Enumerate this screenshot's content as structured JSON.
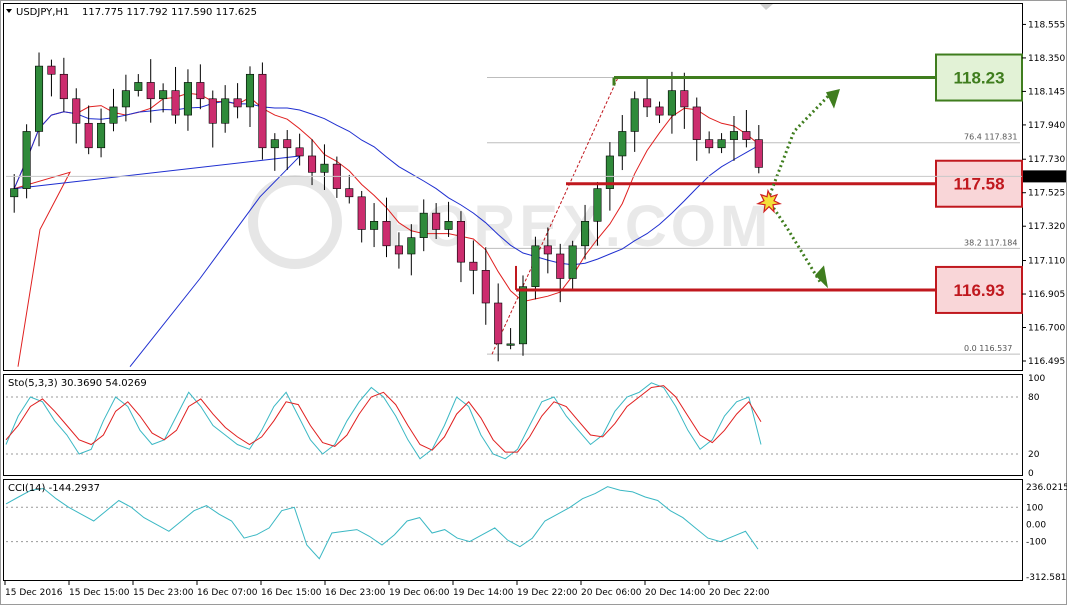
{
  "header": {
    "symbol": "USDJPY,H1",
    "ohlc": "117.775 117.792 117.590 117.625",
    "dropdown_icon": "triangle-down-icon",
    "corner_icon": "chart-window-corner-icon"
  },
  "colors": {
    "bull": "#2f8a3a",
    "bear": "#cc2d6e",
    "ma_fast": "#e02020",
    "ma_slow": "#1f2fd0",
    "stoch_main": "#3bb8c4",
    "stoch_signal": "#e02020",
    "cci": "#3bb8c4",
    "green_level": "#3f7d1e",
    "red_level": "#c0181e",
    "green_box_fill": "#e2f2d6",
    "red_box_fill": "#f9d6d8"
  },
  "chart_data": {
    "type": "candlestick",
    "title": "USDJPY,H1",
    "ylim": [
      116.44,
      118.68
    ],
    "y_ticks": [
      "118.555",
      "118.350",
      "118.145",
      "117.940",
      "117.730",
      "117.525",
      "117.320",
      "117.110",
      "116.905",
      "116.700",
      "116.495"
    ],
    "current_price": "117.625",
    "x_ticks": [
      "15 Dec 2016",
      "15 Dec 15:00",
      "15 Dec 23:00",
      "16 Dec 07:00",
      "16 Dec 15:00",
      "16 Dec 23:00",
      "19 Dec 06:00",
      "19 Dec 14:00",
      "19 Dec 22:00",
      "20 Dec 06:00",
      "20 Dec 14:00",
      "20 Dec 22:00"
    ],
    "candles_summary": "hourly USDJPY bars from 15 Dec 2016 to 20 Dec 2016",
    "close_path": [
      117.55,
      117.9,
      118.3,
      118.25,
      118.1,
      117.95,
      117.8,
      117.95,
      118.05,
      118.15,
      118.2,
      118.1,
      118.15,
      118.0,
      118.2,
      118.1,
      117.95,
      118.1,
      118.05,
      118.25,
      117.8,
      117.85,
      117.8,
      117.75,
      117.65,
      117.7,
      117.55,
      117.5,
      117.3,
      117.35,
      117.2,
      117.15,
      117.25,
      117.4,
      117.3,
      117.35,
      117.1,
      117.05,
      116.85,
      116.6,
      116.6,
      116.95,
      117.2,
      117.15,
      117.0,
      117.2,
      117.35,
      117.55,
      117.75,
      117.9,
      118.1,
      118.05,
      118.0,
      118.15,
      118.05,
      117.85,
      117.8,
      117.85,
      117.9,
      117.85,
      117.68
    ],
    "fibonacci": {
      "levels": [
        {
          "label": "76.4",
          "value": "117.831",
          "price": 117.831
        },
        {
          "label": "38.2",
          "value": "117.184",
          "price": 117.184
        },
        {
          "label": "0.0",
          "value": "116.537",
          "price": 116.537
        }
      ],
      "top": 118.23
    },
    "levels": [
      {
        "label": "118.23",
        "price": 118.23,
        "kind": "resistance"
      },
      {
        "label": "117.58",
        "price": 117.58,
        "kind": "pivot"
      },
      {
        "label": "116.93",
        "price": 116.93,
        "kind": "support"
      }
    ],
    "watermark": "FOREX.COM"
  },
  "stochastic": {
    "label": "Sto(5,3,3) 30.3690 54.0269",
    "axis": [
      "100",
      "80",
      "20",
      "0"
    ],
    "ylim": [
      0,
      100
    ],
    "main": [
      30,
      60,
      80,
      75,
      55,
      40,
      20,
      25,
      55,
      80,
      70,
      45,
      30,
      35,
      60,
      85,
      70,
      50,
      40,
      30,
      25,
      45,
      70,
      85,
      60,
      35,
      20,
      30,
      55,
      75,
      90,
      80,
      60,
      35,
      15,
      25,
      50,
      80,
      70,
      40,
      20,
      15,
      25,
      50,
      75,
      80,
      60,
      45,
      30,
      40,
      65,
      80,
      85,
      95,
      90,
      70,
      45,
      25,
      35,
      60,
      75,
      80,
      30
    ],
    "signal": [
      35,
      50,
      70,
      78,
      65,
      50,
      35,
      30,
      40,
      65,
      75,
      60,
      42,
      35,
      45,
      70,
      78,
      62,
      48,
      38,
      30,
      38,
      55,
      75,
      72,
      50,
      32,
      28,
      40,
      62,
      80,
      85,
      72,
      50,
      30,
      24,
      38,
      62,
      75,
      58,
      35,
      22,
      22,
      38,
      60,
      75,
      70,
      55,
      40,
      38,
      52,
      70,
      80,
      90,
      92,
      80,
      60,
      40,
      32,
      45,
      62,
      75,
      54
    ]
  },
  "cci": {
    "label": "CCI(14) -144.2937",
    "axis": [
      "236.0215",
      "100",
      "0.00",
      "-100",
      "-312.5817"
    ],
    "ylim": [
      -312.5817,
      236.0215
    ],
    "values": [
      120,
      160,
      200,
      210,
      150,
      100,
      60,
      20,
      80,
      140,
      100,
      40,
      0,
      -40,
      20,
      80,
      110,
      60,
      20,
      -80,
      -60,
      -20,
      80,
      100,
      -120,
      -200,
      -50,
      -40,
      -30,
      -70,
      -120,
      -60,
      20,
      40,
      -50,
      -30,
      -80,
      -100,
      -60,
      -20,
      -90,
      -130,
      -80,
      20,
      60,
      100,
      150,
      180,
      220,
      200,
      190,
      160,
      140,
      80,
      40,
      -20,
      -80,
      -100,
      -70,
      -40,
      -144
    ]
  }
}
